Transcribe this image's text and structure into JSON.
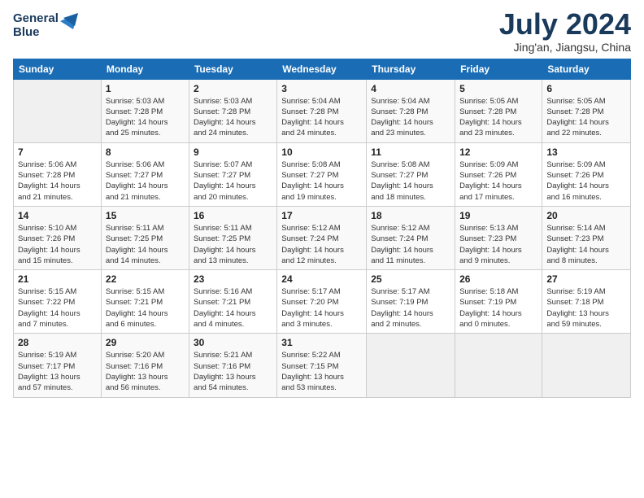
{
  "header": {
    "logo_line1": "General",
    "logo_line2": "Blue",
    "title": "July 2024",
    "subtitle": "Jing'an, Jiangsu, China"
  },
  "columns": [
    "Sunday",
    "Monday",
    "Tuesday",
    "Wednesday",
    "Thursday",
    "Friday",
    "Saturday"
  ],
  "weeks": [
    [
      {
        "day": "",
        "info": ""
      },
      {
        "day": "1",
        "info": "Sunrise: 5:03 AM\nSunset: 7:28 PM\nDaylight: 14 hours\nand 25 minutes."
      },
      {
        "day": "2",
        "info": "Sunrise: 5:03 AM\nSunset: 7:28 PM\nDaylight: 14 hours\nand 24 minutes."
      },
      {
        "day": "3",
        "info": "Sunrise: 5:04 AM\nSunset: 7:28 PM\nDaylight: 14 hours\nand 24 minutes."
      },
      {
        "day": "4",
        "info": "Sunrise: 5:04 AM\nSunset: 7:28 PM\nDaylight: 14 hours\nand 23 minutes."
      },
      {
        "day": "5",
        "info": "Sunrise: 5:05 AM\nSunset: 7:28 PM\nDaylight: 14 hours\nand 23 minutes."
      },
      {
        "day": "6",
        "info": "Sunrise: 5:05 AM\nSunset: 7:28 PM\nDaylight: 14 hours\nand 22 minutes."
      }
    ],
    [
      {
        "day": "7",
        "info": "Sunrise: 5:06 AM\nSunset: 7:28 PM\nDaylight: 14 hours\nand 21 minutes."
      },
      {
        "day": "8",
        "info": "Sunrise: 5:06 AM\nSunset: 7:27 PM\nDaylight: 14 hours\nand 21 minutes."
      },
      {
        "day": "9",
        "info": "Sunrise: 5:07 AM\nSunset: 7:27 PM\nDaylight: 14 hours\nand 20 minutes."
      },
      {
        "day": "10",
        "info": "Sunrise: 5:08 AM\nSunset: 7:27 PM\nDaylight: 14 hours\nand 19 minutes."
      },
      {
        "day": "11",
        "info": "Sunrise: 5:08 AM\nSunset: 7:27 PM\nDaylight: 14 hours\nand 18 minutes."
      },
      {
        "day": "12",
        "info": "Sunrise: 5:09 AM\nSunset: 7:26 PM\nDaylight: 14 hours\nand 17 minutes."
      },
      {
        "day": "13",
        "info": "Sunrise: 5:09 AM\nSunset: 7:26 PM\nDaylight: 14 hours\nand 16 minutes."
      }
    ],
    [
      {
        "day": "14",
        "info": "Sunrise: 5:10 AM\nSunset: 7:26 PM\nDaylight: 14 hours\nand 15 minutes."
      },
      {
        "day": "15",
        "info": "Sunrise: 5:11 AM\nSunset: 7:25 PM\nDaylight: 14 hours\nand 14 minutes."
      },
      {
        "day": "16",
        "info": "Sunrise: 5:11 AM\nSunset: 7:25 PM\nDaylight: 14 hours\nand 13 minutes."
      },
      {
        "day": "17",
        "info": "Sunrise: 5:12 AM\nSunset: 7:24 PM\nDaylight: 14 hours\nand 12 minutes."
      },
      {
        "day": "18",
        "info": "Sunrise: 5:12 AM\nSunset: 7:24 PM\nDaylight: 14 hours\nand 11 minutes."
      },
      {
        "day": "19",
        "info": "Sunrise: 5:13 AM\nSunset: 7:23 PM\nDaylight: 14 hours\nand 9 minutes."
      },
      {
        "day": "20",
        "info": "Sunrise: 5:14 AM\nSunset: 7:23 PM\nDaylight: 14 hours\nand 8 minutes."
      }
    ],
    [
      {
        "day": "21",
        "info": "Sunrise: 5:15 AM\nSunset: 7:22 PM\nDaylight: 14 hours\nand 7 minutes."
      },
      {
        "day": "22",
        "info": "Sunrise: 5:15 AM\nSunset: 7:21 PM\nDaylight: 14 hours\nand 6 minutes."
      },
      {
        "day": "23",
        "info": "Sunrise: 5:16 AM\nSunset: 7:21 PM\nDaylight: 14 hours\nand 4 minutes."
      },
      {
        "day": "24",
        "info": "Sunrise: 5:17 AM\nSunset: 7:20 PM\nDaylight: 14 hours\nand 3 minutes."
      },
      {
        "day": "25",
        "info": "Sunrise: 5:17 AM\nSunset: 7:19 PM\nDaylight: 14 hours\nand 2 minutes."
      },
      {
        "day": "26",
        "info": "Sunrise: 5:18 AM\nSunset: 7:19 PM\nDaylight: 14 hours\nand 0 minutes."
      },
      {
        "day": "27",
        "info": "Sunrise: 5:19 AM\nSunset: 7:18 PM\nDaylight: 13 hours\nand 59 minutes."
      }
    ],
    [
      {
        "day": "28",
        "info": "Sunrise: 5:19 AM\nSunset: 7:17 PM\nDaylight: 13 hours\nand 57 minutes."
      },
      {
        "day": "29",
        "info": "Sunrise: 5:20 AM\nSunset: 7:16 PM\nDaylight: 13 hours\nand 56 minutes."
      },
      {
        "day": "30",
        "info": "Sunrise: 5:21 AM\nSunset: 7:16 PM\nDaylight: 13 hours\nand 54 minutes."
      },
      {
        "day": "31",
        "info": "Sunrise: 5:22 AM\nSunset: 7:15 PM\nDaylight: 13 hours\nand 53 minutes."
      },
      {
        "day": "",
        "info": ""
      },
      {
        "day": "",
        "info": ""
      },
      {
        "day": "",
        "info": ""
      }
    ]
  ]
}
